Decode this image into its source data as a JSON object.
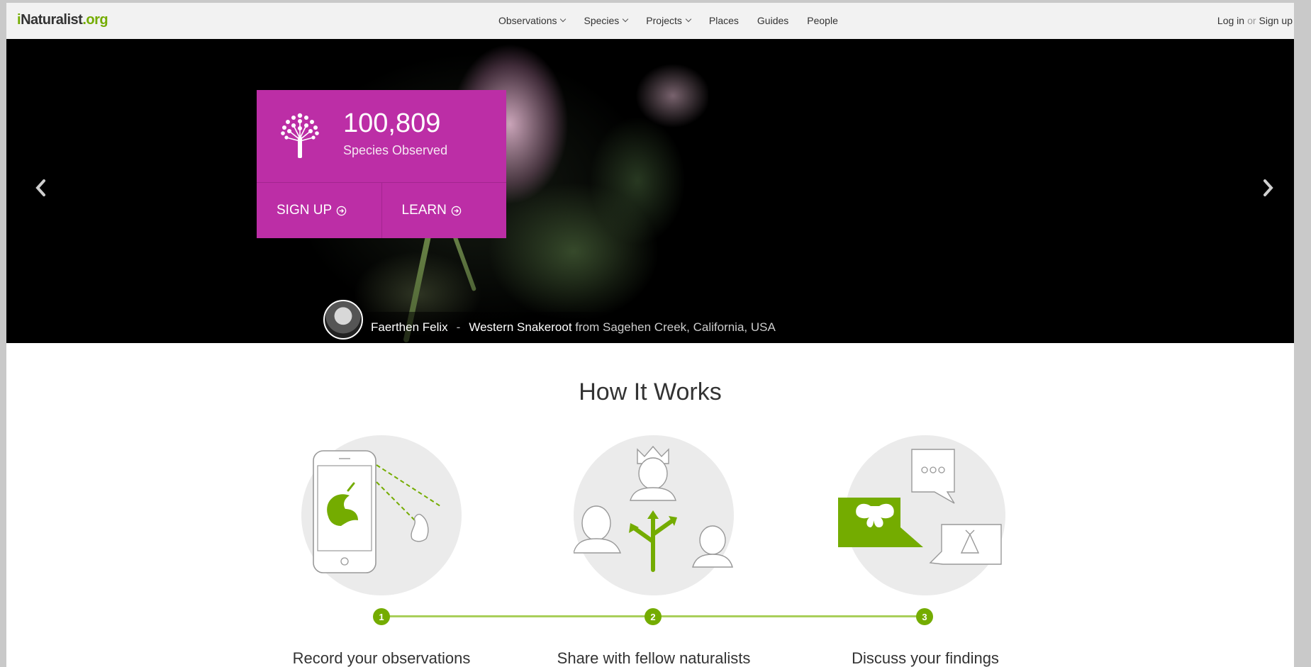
{
  "header": {
    "logo": {
      "i": "i",
      "main": "Naturalist",
      "org": ".org"
    },
    "nav": [
      {
        "label": "Observations",
        "dropdown": true
      },
      {
        "label": "Species",
        "dropdown": true
      },
      {
        "label": "Projects",
        "dropdown": true
      },
      {
        "label": "Places",
        "dropdown": false
      },
      {
        "label": "Guides",
        "dropdown": false
      },
      {
        "label": "People",
        "dropdown": false
      }
    ],
    "login": "Log in",
    "or": "or",
    "signup": "Sign up"
  },
  "hero": {
    "count": "100,809",
    "count_label": "Species Observed",
    "signup_button": "SIGN UP",
    "learn_button": "LEARN",
    "caption": {
      "observer": "Faerthen Felix",
      "separator": "-",
      "species": "Western Snakeroot",
      "location": "from Sagehen Creek, California, USA"
    }
  },
  "how_it_works": {
    "title": "How It Works",
    "steps": [
      {
        "number": "1",
        "label": "Record your observations"
      },
      {
        "number": "2",
        "label": "Share with fellow naturalists"
      },
      {
        "number": "3",
        "label": "Discuss your findings"
      }
    ]
  },
  "colors": {
    "brand_green": "#74ac00",
    "card_magenta": "#bc2ea6",
    "timeline_green": "#a9cf5a"
  },
  "icons": [
    "tree-icon",
    "chevron-left-icon",
    "chevron-right-icon",
    "circle-arrow-icon",
    "phone-caterpillar-icon",
    "people-share-icon",
    "chat-bubbles-icon"
  ]
}
